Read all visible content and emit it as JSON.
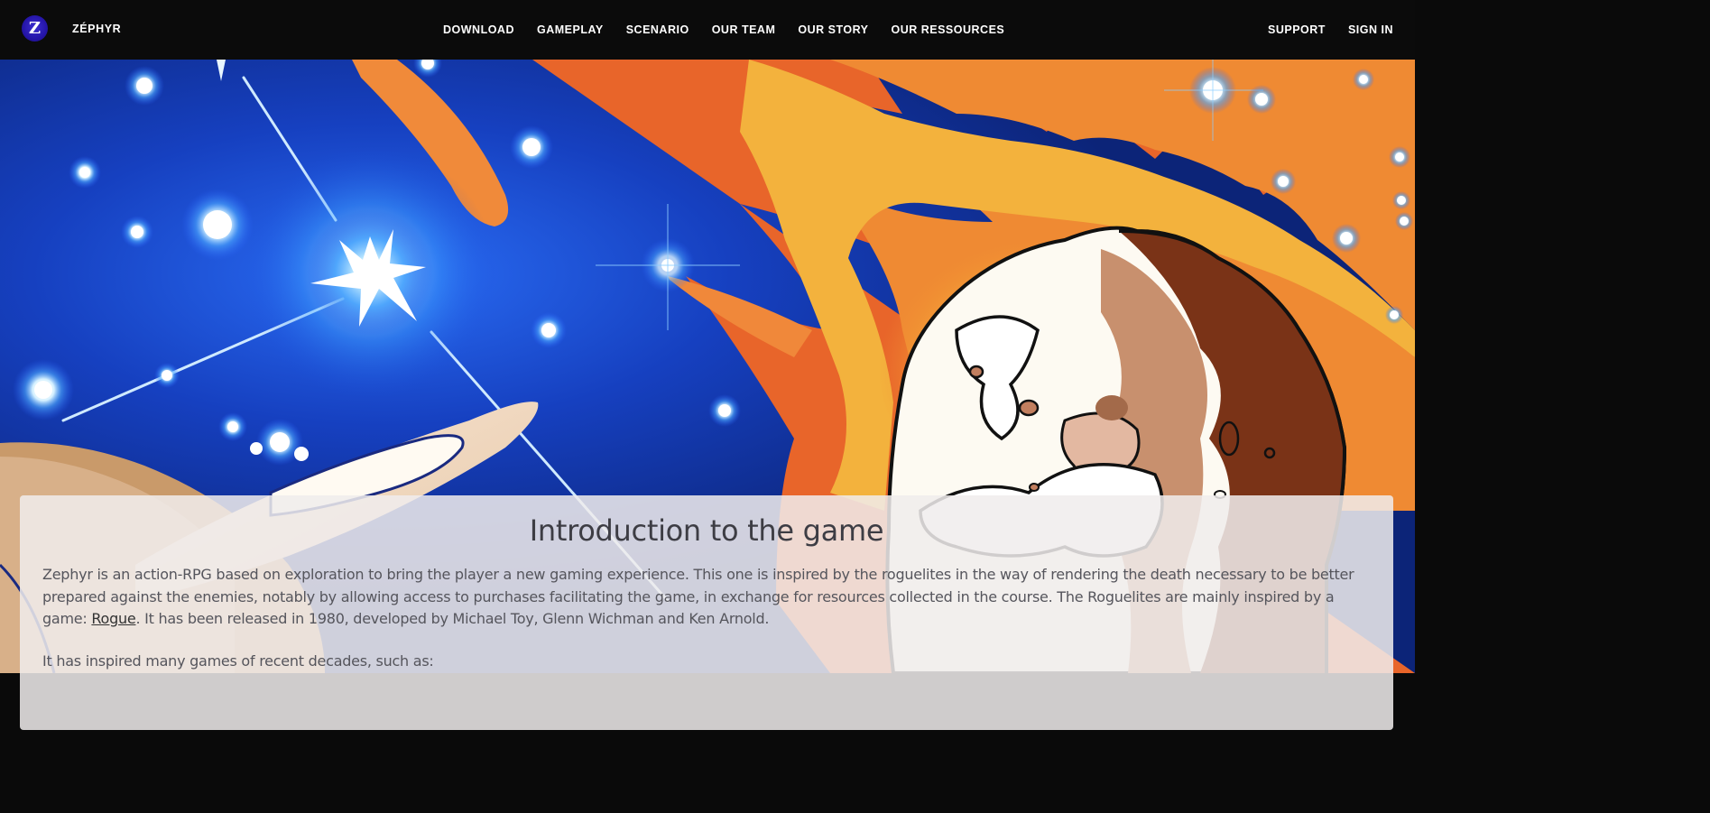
{
  "brand": {
    "logo_letter": "Z",
    "name": "ZÉPHYR"
  },
  "nav": {
    "center": [
      {
        "label": "DOWNLOAD"
      },
      {
        "label": "GAMEPLAY"
      },
      {
        "label": "SCENARIO"
      },
      {
        "label": "OUR TEAM"
      },
      {
        "label": "OUR STORY"
      },
      {
        "label": "OUR RESSOURCES"
      }
    ],
    "right": [
      {
        "label": "SUPPORT"
      },
      {
        "label": "SIGN IN"
      }
    ]
  },
  "colors": {
    "navbar": "#0b0b0b",
    "space_blue": "#0d2a8a",
    "fire_orange": "#e8652a",
    "card_bg": "#f0ecec"
  },
  "intro": {
    "title": "Introduction to the game",
    "paragraph_before_link": "Zephyr is an action-RPG based on exploration to bring the player a new gaming experience. This one is inspired by the roguelites in the way of rendering the death necessary to be better prepared against the enemies, notably by allowing access to purchases facilitating the game, in exchange for resources collected in the course. The Roguelites are mainly inspired by a game: ",
    "link_text": "Rogue",
    "paragraph_after_link": ". It has been released in 1980, developed by Michael Toy, Glenn Wichman and Ken Arnold.",
    "paragraph_2": "It has inspired many games of recent decades, such as:"
  }
}
